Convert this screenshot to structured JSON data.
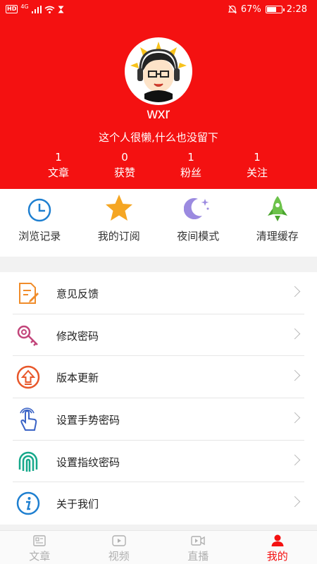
{
  "status_bar": {
    "hd": "HD",
    "network": "4G",
    "battery_percent": "67%",
    "battery_level": 0.67,
    "time": "2:28"
  },
  "profile": {
    "username": "wxr",
    "bio": "这个人很懒,什么也没留下",
    "stats": [
      {
        "count": "1",
        "label": "文章"
      },
      {
        "count": "0",
        "label": "获赞"
      },
      {
        "count": "1",
        "label": "粉丝"
      },
      {
        "count": "1",
        "label": "关注"
      }
    ]
  },
  "quick_actions": [
    {
      "label": "浏览记录",
      "icon": "clock-icon"
    },
    {
      "label": "我的订阅",
      "icon": "star-icon"
    },
    {
      "label": "夜间模式",
      "icon": "moon-icon"
    },
    {
      "label": "清理缓存",
      "icon": "rocket-icon"
    }
  ],
  "menu": [
    {
      "label": "意见反馈",
      "icon": "feedback-icon"
    },
    {
      "label": "修改密码",
      "icon": "key-icon"
    },
    {
      "label": "版本更新",
      "icon": "update-icon"
    },
    {
      "label": "设置手势密码",
      "icon": "gesture-icon"
    },
    {
      "label": "设置指纹密码",
      "icon": "fingerprint-icon"
    },
    {
      "label": "关于我们",
      "icon": "info-icon"
    }
  ],
  "bottom_nav": [
    {
      "label": "文章",
      "icon": "article-icon",
      "active": false
    },
    {
      "label": "视频",
      "icon": "video-icon",
      "active": false
    },
    {
      "label": "直播",
      "icon": "live-icon",
      "active": false
    },
    {
      "label": "我的",
      "icon": "profile-icon",
      "active": true
    }
  ],
  "colors": {
    "primary_red": "#f41111",
    "clock_blue": "#1e7fd0",
    "star_orange": "#f5a623",
    "moon_purple": "#9b8ae0",
    "rocket_green": "#6cc24a"
  }
}
